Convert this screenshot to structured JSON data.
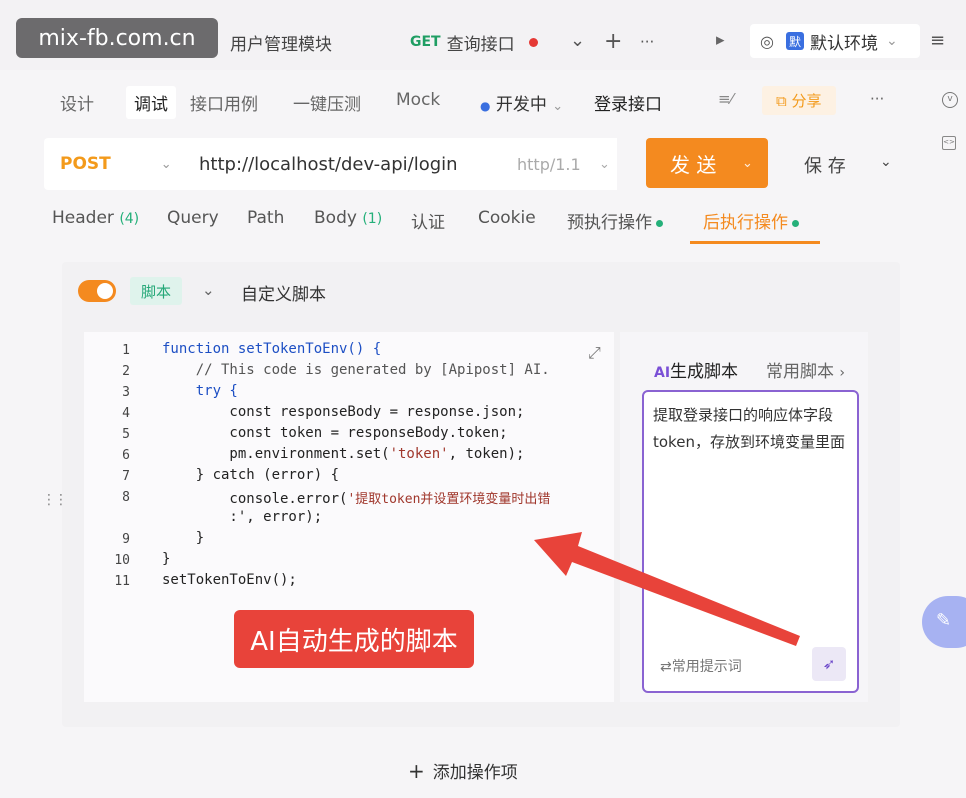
{
  "watermark": "mix-fb.com.cn",
  "top_tabs": [
    {
      "label": "用户管理模块"
    },
    {
      "method": "GET",
      "label": "查询接口"
    }
  ],
  "top_controls": {
    "chevron": "⌄",
    "plus": "+",
    "more": "···",
    "play": "▸"
  },
  "environment": {
    "badge": "默",
    "label": "默认环境",
    "chevron": "⌄",
    "menu": "≡"
  },
  "mode_tabs": [
    "设计",
    "调试",
    "接口用例",
    "一键压测",
    "Mock"
  ],
  "status": {
    "label": "开发中",
    "chevron": "⌄"
  },
  "api_name": "登录接口",
  "share_label": "分享",
  "more_label": "···",
  "request": {
    "method": "POST",
    "url": "http://localhost/dev-api/login",
    "protocol": "http/1.1",
    "send_label": "发 送",
    "save_label": "保 存"
  },
  "param_tabs": [
    {
      "label": "Header",
      "count": "(4)"
    },
    {
      "label": "Query"
    },
    {
      "label": "Path"
    },
    {
      "label": "Body",
      "count": "(1)"
    },
    {
      "label": "认证"
    },
    {
      "label": "Cookie"
    },
    {
      "label": "预执行操作"
    },
    {
      "label": "后执行操作"
    }
  ],
  "script_header": {
    "tag": "脚本",
    "title": "自定义脚本",
    "chevron": "⌄"
  },
  "code": {
    "line_numbers": [
      "1",
      "2",
      "3",
      "4",
      "5",
      "6",
      "7",
      "8",
      "",
      "9",
      "10",
      "11"
    ],
    "line1": "function setTokenToEnv() {",
    "line2": "    // This code is generated by [Apipost] AI.",
    "line3": "    try {",
    "line4": "        const responseBody = response.json;",
    "line5": "        const token = responseBody.token;",
    "line6a": "        pm.environment.set(",
    "line6b": "'token'",
    "line6c": ", token);",
    "line7": "    } catch (error) {",
    "line8a": "        console.error(",
    "line8b": "'提取token并设置环境变量时出错",
    "line8c": "        :', error);",
    "line9": "    }",
    "line10": "}",
    "line11": "setTokenToEnv();"
  },
  "ai_panel": {
    "tab_ai": "生成脚本",
    "tab_ai_prefix": "AI",
    "tab_common": "常用脚本",
    "prompt_text": "提取登录接口的响应体字段token，存放到环境变量里面",
    "hint": "常用提示词"
  },
  "annotation": "AI自动生成的脚本",
  "add_operation": "添加操作项",
  "colors": {
    "accent": "#f48a1f",
    "green": "#25b07a",
    "annotation_red": "#e8433a",
    "ai_purple": "#8a63d2"
  }
}
